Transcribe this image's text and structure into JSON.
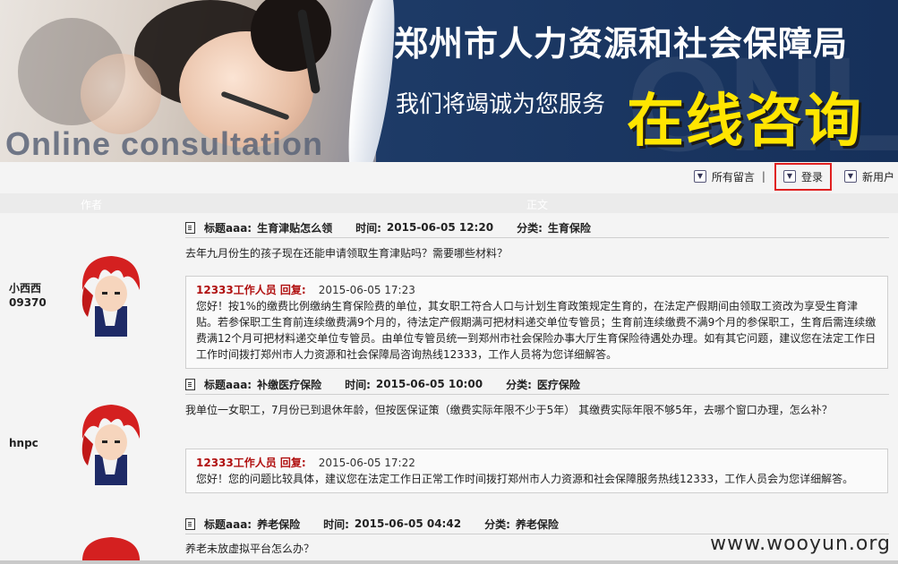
{
  "banner": {
    "title": "郑州市人力资源和社会保障局",
    "subtitle": "我们将竭诚为您服务",
    "big_text": "在线咨询",
    "english_text": "Online consultation",
    "bg_text": "ONLINE"
  },
  "toplinks": {
    "all_messages": "所有留言",
    "separator": "|",
    "login": "登录",
    "new_user": "新用户"
  },
  "table_header": {
    "author": "作者",
    "body": "正文"
  },
  "posts": [
    {
      "user_name": "小西西",
      "user_id": "09370",
      "title_label": "标题aaa:",
      "title": "生育津贴怎么领",
      "time_label": "时间:",
      "time": "2015-06-05 12:20",
      "category_label": "分类:",
      "category": "生育保险",
      "question": "去年九月份生的孩子现在还能申请领取生育津贴吗？需要哪些材料？",
      "reply_author": "12333工作人员 回复:",
      "reply_time": "2015-06-05 17:23",
      "reply_text": "您好！按1%的缴费比例缴纳生育保险费的单位，其女职工符合人口与计划生育政策规定生育的，在法定产假期间由领取工资改为享受生育津贴。若参保职工生育前连续缴费满9个月的，待法定产假期满可把材料递交单位专管员；生育前连续缴费不满9个月的参保职工，生育后需连续缴费满12个月可把材料递交单位专管员。由单位专管员统一到郑州市社会保险办事大厅生育保险待遇处办理。如有其它问题，建议您在法定工作日工作时间拨打郑州市人力资源和社会保障局咨询热线12333，工作人员将为您详细解答。"
    },
    {
      "user_name": "hnpc",
      "user_id": "",
      "title_label": "标题aaa:",
      "title": "补缴医疗保险",
      "time_label": "时间:",
      "time": "2015-06-05 10:00",
      "category_label": "分类:",
      "category": "医疗保险",
      "question": "我单位一女职工，7月份已到退休年龄，但按医保证策（缴费实际年限不少于5年） 其缴费实际年限不够5年，去哪个窗口办理，怎么补？",
      "reply_author": "12333工作人员 回复:",
      "reply_time": "2015-06-05 17:22",
      "reply_text": "您好！您的问题比较具体，建议您在法定工作日正常工作时间拨打郑州市人力资源和社会保障服务热线12333，工作人员会为您详细解答。"
    },
    {
      "user_name": "",
      "user_id": "",
      "title_label": "标题aaa:",
      "title": "养老保险",
      "time_label": "时间:",
      "time": "2015-06-05 04:42",
      "category_label": "分类:",
      "category": "养老保险",
      "question": "养老未放虚拟平台怎么办？"
    }
  ],
  "watermark": "www.wooyun.org",
  "colors": {
    "reply_red": "#b01010",
    "login_highlight": "#e02020",
    "banner_yellow": "#ffe500"
  },
  "icons": {
    "link_icon": "circle-arrow-icon",
    "doc_icon": "document-icon"
  }
}
